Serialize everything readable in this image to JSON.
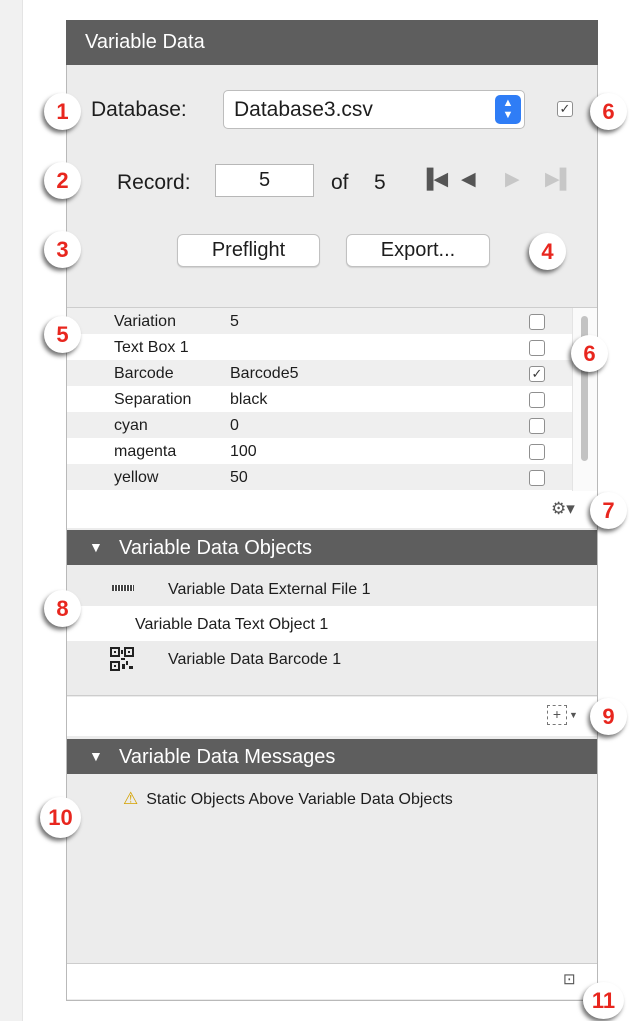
{
  "panel": {
    "title": "Variable Data"
  },
  "database": {
    "label": "Database:",
    "value": "Database3.csv",
    "checked": true
  },
  "record": {
    "label": "Record:",
    "value": "5",
    "of_label": "of",
    "total": "5"
  },
  "navigation": {
    "first": "first-record-icon",
    "previous": "previous-record-icon",
    "next": "next-record-icon",
    "last": "last-record-icon"
  },
  "buttons": {
    "preflight": "Preflight",
    "export": "Export..."
  },
  "fields": [
    {
      "name": "Variation",
      "value": "5",
      "checked": false
    },
    {
      "name": "Text Box 1",
      "value": "",
      "checked": false
    },
    {
      "name": "Barcode",
      "value": "Barcode5",
      "checked": true
    },
    {
      "name": "Separation",
      "value": "black",
      "checked": false
    },
    {
      "name": "cyan",
      "value": "0",
      "checked": false
    },
    {
      "name": "magenta",
      "value": "100",
      "checked": false
    },
    {
      "name": "yellow",
      "value": "50",
      "checked": false
    }
  ],
  "objects_section": {
    "title": "Variable Data Objects",
    "items": [
      "Variable Data External File 1",
      "Variable Data Text Object 1",
      "Variable Data Barcode 1"
    ]
  },
  "messages_section": {
    "title": "Variable Data Messages",
    "items": [
      "Static Objects Above Variable Data Objects"
    ]
  },
  "callouts": [
    "1",
    "2",
    "3",
    "4",
    "5",
    "6",
    "6",
    "7",
    "8",
    "9",
    "10",
    "11"
  ],
  "colors": {
    "header": "#5e5e5e",
    "callout_text": "#e8261e",
    "accent": "#2f7df6",
    "warning": "#d4a200"
  },
  "icons": {
    "settings": "gear-icon",
    "add_object": "add-object-icon",
    "zoom": "zoom-icon",
    "warning": "warning-icon"
  }
}
